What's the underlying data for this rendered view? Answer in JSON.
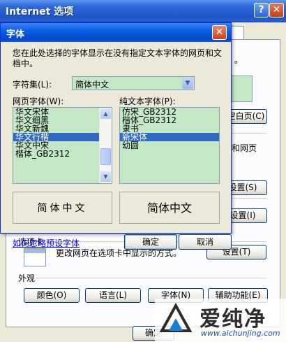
{
  "background_window": {
    "title": "Internet 选项",
    "help_glyph": "?",
    "close_glyph": "✕",
    "right_texts": [
      "ₒ",
      "白页(",
      "和网页"
    ],
    "buttons": {
      "white_page": "空白页(C)",
      "settings1": "设置(S)",
      "settings2": "设置(I)",
      "tabs_settings": "设置(T)"
    },
    "tabs_group_label": "选项卡",
    "tabs_description": "更改网页在选项卡中显示的方式。",
    "appearance_label": "外观",
    "appearance_buttons": [
      "颜色(O)",
      "语言(L)",
      "字体(N)",
      "辅助功能(E)"
    ],
    "bottom_button_partial": "确定"
  },
  "fonts_dialog": {
    "title": "字体",
    "close_glyph": "✕",
    "description": "您在此处选择的字体显示在没有指定文本字体的网页和文档中。",
    "charset_label": "字符集(L):",
    "charset_value": "简体中文",
    "webpage_font_label": "网页字体(W):",
    "webpage_fonts": [
      "华文宋体",
      "华文细黑",
      "华文新魏",
      "华文行楷",
      "华文中宋",
      "楷体_GB2312"
    ],
    "webpage_selected_index": 3,
    "plaintext_font_label": "纯文本字体(P):",
    "plaintext_fonts": [
      "仿宋_GB2312",
      "楷体_GB2312",
      "隶书",
      "新宋体",
      "幼圆"
    ],
    "plaintext_selected_index": 3,
    "preview_left": "简体中文",
    "preview_right": "简体中文",
    "link_text": "如何忽略预设字体",
    "ok_label": "确定",
    "cancel_label": "取消"
  },
  "watermark": {
    "brand": "爱纯净",
    "url": "www.aichunjing.com"
  },
  "colors": {
    "titlebar": "#0a5fe8",
    "list_bg": "#c4e7c6",
    "selection": "#316ac5",
    "dialog_bg": "#ece9d8"
  }
}
